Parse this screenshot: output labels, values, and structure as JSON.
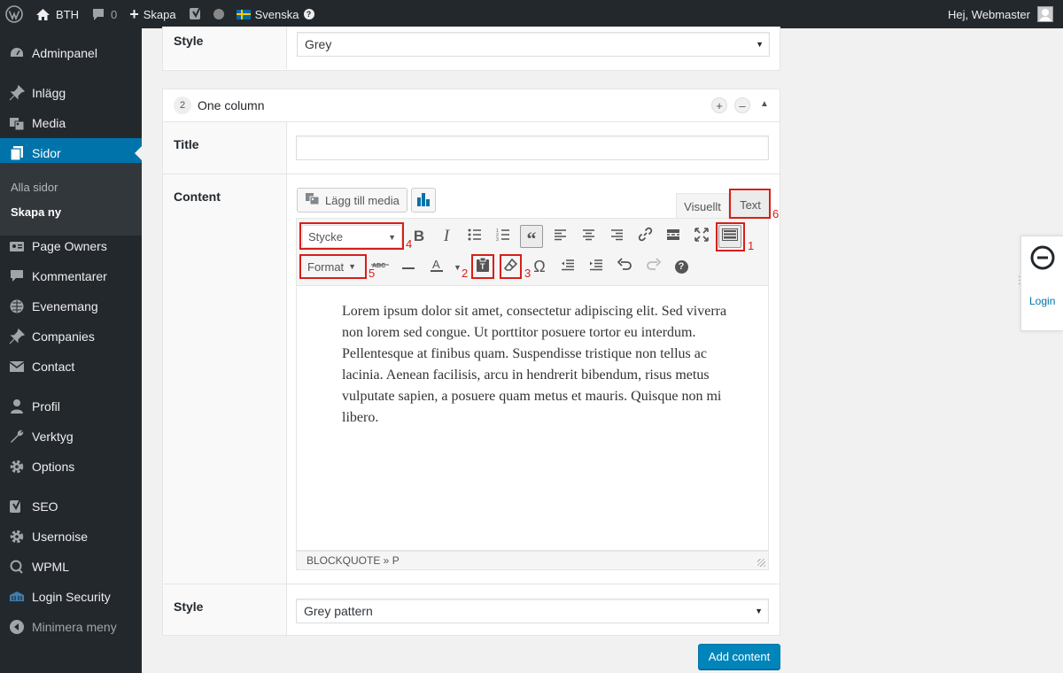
{
  "adminbar": {
    "site_name": "BTH",
    "comments_count": "0",
    "new_label": "Skapa",
    "language": "Svenska",
    "greeting": "Hej, Webmaster"
  },
  "sidebar": {
    "items": [
      {
        "label": "Adminpanel",
        "icon": "dashboard-icon"
      },
      {
        "label": "Inlägg",
        "icon": "pin-icon"
      },
      {
        "label": "Media",
        "icon": "media-icon"
      },
      {
        "label": "Sidor",
        "icon": "page-icon"
      },
      {
        "label": "Page Owners",
        "icon": "id-card-icon"
      },
      {
        "label": "Kommentarer",
        "icon": "comment-icon"
      },
      {
        "label": "Evenemang",
        "icon": "calendar-icon"
      },
      {
        "label": "Companies",
        "icon": "pin-icon"
      },
      {
        "label": "Contact",
        "icon": "mail-icon"
      },
      {
        "label": "Profil",
        "icon": "user-icon"
      },
      {
        "label": "Verktyg",
        "icon": "wrench-icon"
      },
      {
        "label": "Options",
        "icon": "gear-icon"
      },
      {
        "label": "SEO",
        "icon": "yoast-icon"
      },
      {
        "label": "Usernoise",
        "icon": "gear-icon"
      },
      {
        "label": "WPML",
        "icon": "wpml-icon"
      },
      {
        "label": "Login Security",
        "icon": "shield-icon"
      },
      {
        "label": "Minimera meny",
        "icon": "collapse-icon"
      }
    ],
    "submenu": [
      "Alla sidor",
      "Skapa ny"
    ]
  },
  "panel_top": {
    "style_label": "Style",
    "style_value": "Grey"
  },
  "panel_main": {
    "number": "2",
    "title": "One column",
    "title_label": "Title",
    "title_value": "",
    "content_label": "Content",
    "add_media_label": "Lägg till media",
    "tab_visual": "Visuellt",
    "tab_text": "Text",
    "paragraph_dropdown": "Stycke",
    "format_dropdown": "Format",
    "annotations": [
      "1",
      "2",
      "3",
      "4",
      "5",
      "6"
    ],
    "body_text": "Lorem ipsum dolor sit amet, consectetur adipiscing elit. Sed viverra non lorem sed congue. Ut porttitor posuere tortor eu interdum. Pellentesque at finibus quam. Suspendisse tristique non tellus ac lacinia. Aenean facilisis, arcu in hendrerit bibendum, risus metus vulputate sapien, a posuere quam metus et mauris. Quisque non mi libero.",
    "status_path": "BLOCKQUOTE » P",
    "style_label": "Style",
    "style_value": "Grey pattern"
  },
  "add_content_label": "Add content",
  "login_widget": {
    "label": "Login"
  },
  "colors": {
    "sidebar_bg": "#23282d",
    "active_menu": "#0073aa",
    "primary_button": "#0085ba",
    "annotation_red": "#d91e18"
  }
}
